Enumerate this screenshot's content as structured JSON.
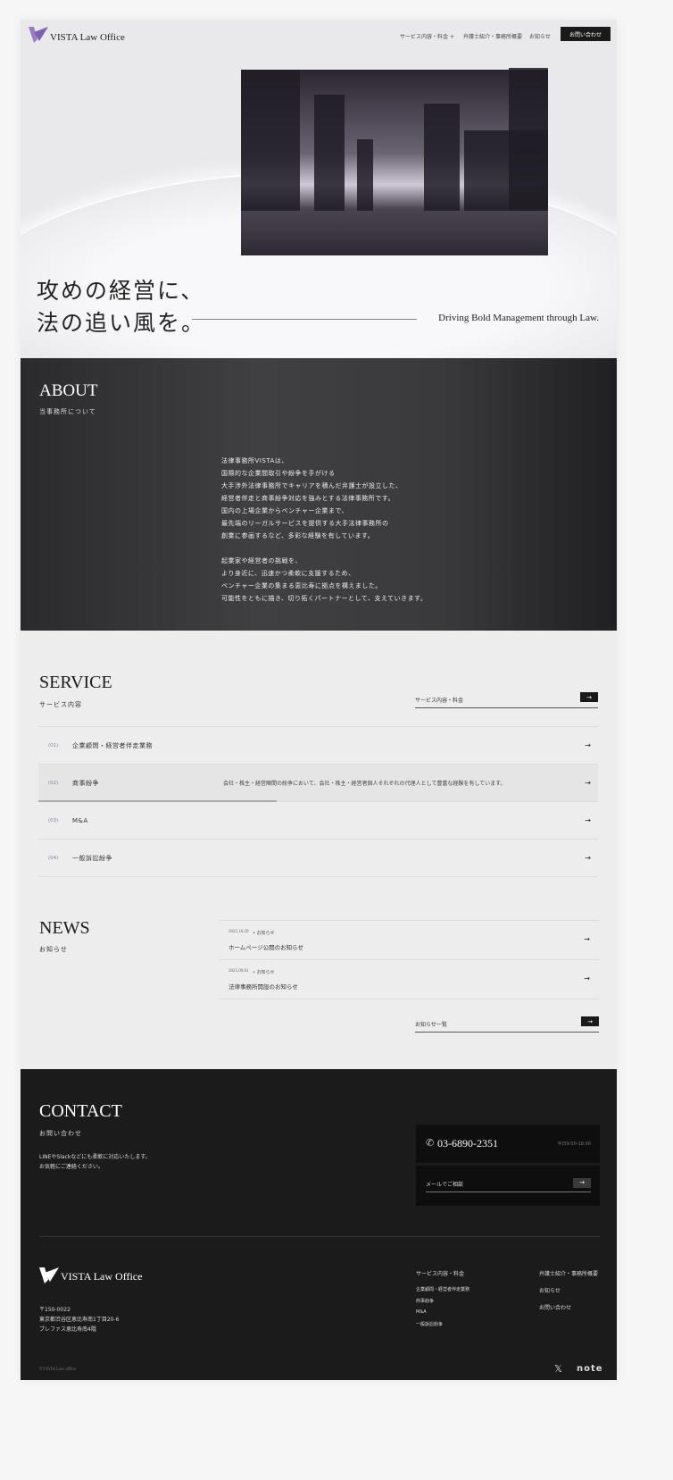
{
  "header": {
    "logo": "VISTA Law Office",
    "nav": [
      "サービス内容・料金 +",
      "弁護士紹介・事務所概要",
      "お知らせ"
    ],
    "cta": "お問い合わせ"
  },
  "hero": {
    "line1": "攻めの経営に、",
    "line2": "法の追い風を。",
    "tagline": "Driving Bold Management through Law."
  },
  "about": {
    "title": "ABOUT",
    "subtitle": "当事務所について",
    "paragraph1": [
      "法律事務所VISTAは、",
      "国際的な企業間取引や紛争を手がける",
      "大手渉外法律事務所でキャリアを積んだ弁護士が設立した、",
      "経営者伴走と商事紛争対応を強みとする法律事務所です。",
      "国内の上場企業からベンチャー企業まで、",
      "最先端のリーガルサービスを提供する大手法律事務所の",
      "創業に参画するなど、多彩な経験を有しています。"
    ],
    "paragraph2": [
      "起業家や経営者の挑戦を、",
      "より身近に、迅速かつ柔軟に支援するため、",
      "ベンチャー企業の集まる恵比寿に拠点を構えました。",
      "可能性をともに描き、切り拓くパートナーとして、支えていきます。"
    ]
  },
  "service": {
    "title": "SERVICE",
    "subtitle": "サービス内容",
    "link": "サービス内容・料金",
    "items": [
      {
        "num": "(01)",
        "label": "企業顧問・経営者伴走業務",
        "desc": ""
      },
      {
        "num": "(02)",
        "label": "商事紛争",
        "desc": "会社・株主・経営陣間の紛争において、会社・株主・経営者個人それぞれの代理人として豊富な経験を有しています。"
      },
      {
        "num": "(03)",
        "label": "M&A",
        "desc": ""
      },
      {
        "num": "(04)",
        "label": "一般訴訟紛争",
        "desc": ""
      }
    ]
  },
  "news": {
    "title": "NEWS",
    "subtitle": "お知らせ",
    "items": [
      {
        "date": "2025.10.29",
        "category": "• お知らせ",
        "title": "ホームページ公開のお知らせ"
      },
      {
        "date": "2025.09.01",
        "category": "• お知らせ",
        "title": "法律事務所開設のお知らせ"
      }
    ],
    "link": "お知らせ一覧"
  },
  "contact": {
    "title": "CONTACT",
    "subtitle": "お問い合わせ",
    "text1": "LINEやSlackなどにも柔軟に対応いたします。",
    "text2": "お気軽にご連絡ください。",
    "phone": "03-6890-2351",
    "hours": "平日9:00-18:00",
    "mail": "メールでご相談"
  },
  "footer": {
    "logo": "VISTA Law Office",
    "address": [
      "〒150-0022",
      "東京都渋谷区恵比寿南1丁目20-6",
      "プレファス恵比寿南4階"
    ],
    "col1_title": "サービス内容・料金",
    "col1": [
      "企業顧問・経営者伴走業務",
      "商事紛争",
      "M&A",
      "一般訴訟紛争"
    ],
    "col2": [
      "弁護士紹介・事務所概要",
      "お知らせ",
      "お問い合わせ"
    ],
    "copyright": "©VISTA Law office",
    "x": "𝕏",
    "note": "note"
  },
  "arrow": "→"
}
